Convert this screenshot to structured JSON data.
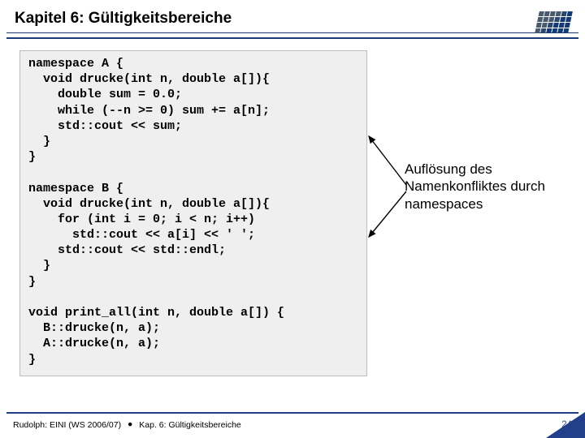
{
  "header": {
    "title": "Kapitel 6: Gültigkeitsbereiche"
  },
  "code": {
    "line01": "namespace A {",
    "line02": "  void drucke(int n, double a[]){",
    "line03": "    double sum = 0.0;",
    "line04": "    while (--n >= 0) sum += a[n];",
    "line05": "    std::cout << sum;",
    "line06": "  }",
    "line07": "}",
    "line08": "",
    "line09": "namespace B {",
    "line10": "  void drucke(int n, double a[]){",
    "line11": "    for (int i = 0; i < n; i++)",
    "line12": "      std::cout << a[i] << ' ';",
    "line13": "    std::cout << std::endl;",
    "line14": "  }",
    "line15": "}",
    "line16": "",
    "line17": "void print_all(int n, double a[]) {",
    "line18": "  B::drucke(n, a);",
    "line19": "  A::drucke(n, a);",
    "line20": "}"
  },
  "annotation": {
    "text": "Auflösung des Namenkonfliktes durch namespaces"
  },
  "footer": {
    "left_author": "Rudolph: EINI (WS 2006/07)",
    "left_chapter": "Kap. 6: Gültigkeitsbereiche",
    "page": "24"
  },
  "logo": {
    "colors": [
      "#4a5a6e",
      "#4a5a6e",
      "#4a5a6e",
      "#4a5a6e",
      "#2a476f",
      "#123a77",
      "#4a5a6e",
      "#4a5a6e",
      "#4a5a6e",
      "#2a476f",
      "#123a77",
      "#123a77",
      "#4a5a6e",
      "#4a5a6e",
      "#2a476f",
      "#123a77",
      "#123a77",
      "#123a77",
      "#4a5a6e",
      "#2a476f",
      "#123a77",
      "#123a77",
      "#123a77",
      "#123a77"
    ]
  }
}
